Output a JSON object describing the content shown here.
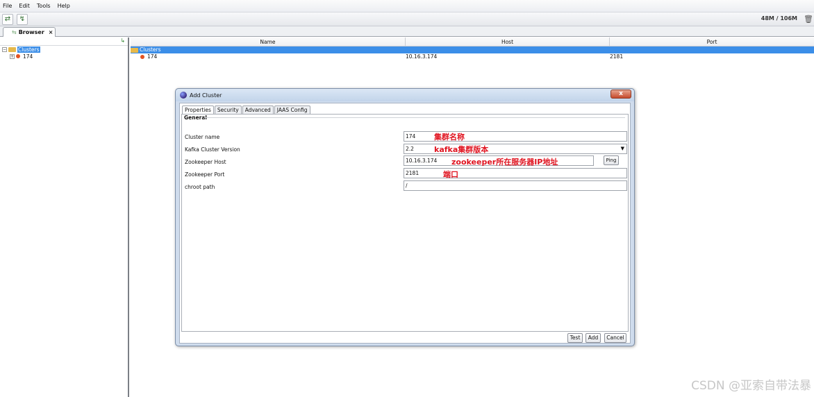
{
  "menu": [
    "File",
    "Edit",
    "Tools",
    "Help"
  ],
  "toolbar": {
    "memory": "48M / 106M"
  },
  "browser_tab": {
    "label": "Browser",
    "close": "×"
  },
  "tree": {
    "root": "Clusters",
    "child": "174",
    "expander": "⊞"
  },
  "grid": {
    "headers": {
      "name": "Name",
      "host": "Host",
      "port": "Port"
    },
    "rows": [
      {
        "name": "Clusters",
        "host": "",
        "port": ""
      },
      {
        "name": "174",
        "host": "10.16.3.174",
        "port": "2181"
      }
    ]
  },
  "dialog": {
    "title": "Add Cluster",
    "tabs": [
      "Properties",
      "Security",
      "Advanced",
      "JAAS Config"
    ],
    "group": "General",
    "fields": {
      "cluster_name": {
        "label": "Cluster name",
        "value": "174"
      },
      "kafka_version": {
        "label": "Kafka Cluster Version",
        "value": "2.2"
      },
      "zk_host": {
        "label": "Zookeeper Host",
        "value": "10.16.3.174"
      },
      "zk_port": {
        "label": "Zookeeper Port",
        "value": "2181"
      },
      "chroot": {
        "label": "chroot path",
        "value": "/"
      }
    },
    "ping": "Ping",
    "buttons": {
      "test": "Test",
      "add": "Add",
      "cancel": "Cancel"
    },
    "notes": {
      "cluster_name": "集群名称",
      "kafka_version": "kafka集群版本",
      "zk_host": "zookeeper所在服务器IP地址",
      "zk_port": "端口"
    }
  },
  "watermark": "CSDN @亚索自带法暴"
}
